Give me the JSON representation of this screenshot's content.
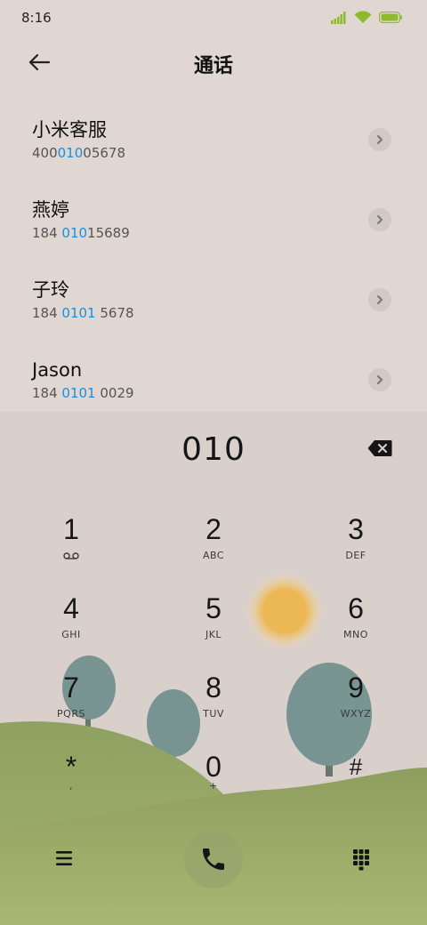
{
  "status_bar": {
    "time": "8:16",
    "icons": [
      "signal-icon",
      "wifi-icon",
      "battery-icon"
    ],
    "accent_color": "#8dbb2d"
  },
  "header": {
    "title": "通话",
    "back_icon": "back-arrow-icon"
  },
  "contacts": [
    {
      "name": "小米客服",
      "number_pre": "400",
      "number_match": "010",
      "number_post": "05678"
    },
    {
      "name": "燕婷",
      "number_pre": "184 ",
      "number_match": "010",
      "number_post": "15689"
    },
    {
      "name": "子玲",
      "number_pre": "184 ",
      "number_match": "0101",
      "number_post": " 5678"
    },
    {
      "name": "Jason",
      "number_pre": "184 ",
      "number_match": "0101",
      "number_post": " 0029"
    }
  ],
  "highlight_color": "#1a8fe0",
  "dialer": {
    "entered_number": "010",
    "keys": [
      {
        "digit": "1",
        "letters": ""
      },
      {
        "digit": "2",
        "letters": "ABC"
      },
      {
        "digit": "3",
        "letters": "DEF"
      },
      {
        "digit": "4",
        "letters": "GHI"
      },
      {
        "digit": "5",
        "letters": "JKL"
      },
      {
        "digit": "6",
        "letters": "MNO"
      },
      {
        "digit": "7",
        "letters": "PQRS"
      },
      {
        "digit": "8",
        "letters": "TUV"
      },
      {
        "digit": "9",
        "letters": "WXYZ"
      },
      {
        "digit": "*",
        "letters": ","
      },
      {
        "digit": "0",
        "letters": "+"
      },
      {
        "digit": "#",
        "letters": ""
      }
    ],
    "voicemail_icon": "voicemail-icon"
  },
  "bottom_bar": {
    "menu_icon": "menu-icon",
    "call_icon": "phone-icon",
    "dialpad_icon": "dialpad-icon"
  }
}
